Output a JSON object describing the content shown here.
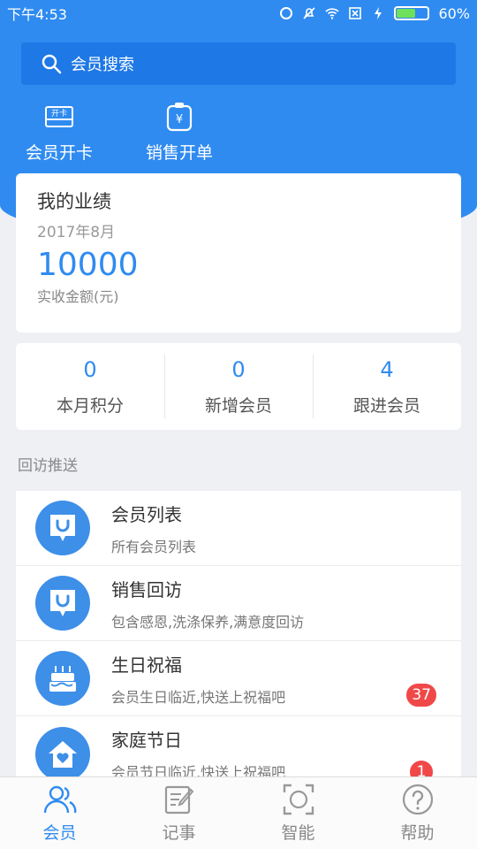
{
  "status_bar": {
    "time": "下午4:53",
    "battery": "60%",
    "battery_level": 0.6
  },
  "search": {
    "placeholder": "会员搜索",
    "icon": "search-icon"
  },
  "quick_actions": [
    {
      "label": "会员开卡",
      "icon": "card-icon",
      "icon_text": "开卡"
    },
    {
      "label": "销售开单",
      "icon": "yuan-clipboard-icon",
      "icon_text": "¥"
    }
  ],
  "performance": {
    "title": "我的业绩",
    "month": "2017年8月",
    "amount": "10000",
    "amount_label": "实收金额(元)"
  },
  "stats": [
    {
      "value": "0",
      "label": "本月积分"
    },
    {
      "value": "0",
      "label": "新增会员"
    },
    {
      "value": "4",
      "label": "跟进会员"
    }
  ],
  "section_title": "回访推送",
  "list": [
    {
      "title": "会员列表",
      "subtitle": "所有会员列表",
      "icon": "bag-icon",
      "badge": ""
    },
    {
      "title": "销售回访",
      "subtitle": "包含感恩,洗涤保养,满意度回访",
      "icon": "bag-icon",
      "badge": ""
    },
    {
      "title": "生日祝福",
      "subtitle": "会员生日临近,快送上祝福吧",
      "icon": "cake-icon",
      "badge": "37"
    },
    {
      "title": "家庭节日",
      "subtitle": "会员节日临近,快送上祝福吧",
      "icon": "home-heart-icon",
      "badge": "1"
    }
  ],
  "tabs": [
    {
      "label": "会员",
      "icon": "member-icon",
      "active": true
    },
    {
      "label": "记事",
      "icon": "note-icon",
      "active": false
    },
    {
      "label": "智能",
      "icon": "scan-icon",
      "active": false
    },
    {
      "label": "帮助",
      "icon": "help-icon",
      "active": false
    }
  ],
  "colors": {
    "primary": "#2f8bf0",
    "badge": "#f04848"
  }
}
